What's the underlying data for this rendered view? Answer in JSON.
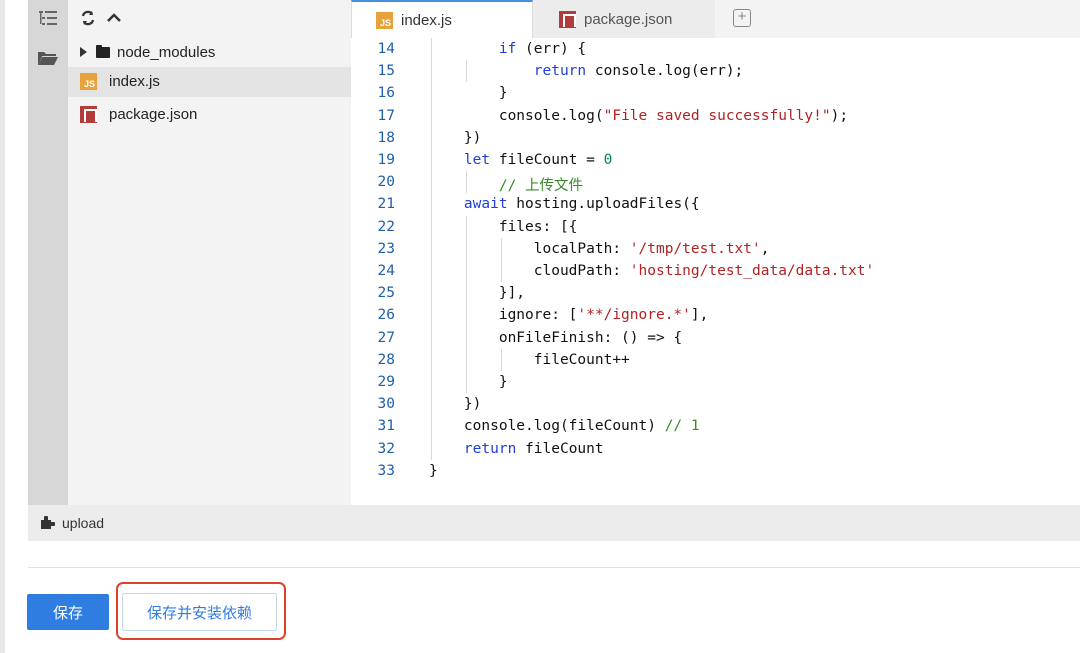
{
  "activity_bar": {
    "icons": [
      "outline-icon",
      "folder-icon"
    ]
  },
  "sidebar": {
    "toolbar_icons": [
      "refresh-icon",
      "collapse-icon"
    ],
    "tree": [
      {
        "type": "folder",
        "label": "node_modules",
        "icon": "folder-icon"
      },
      {
        "type": "file",
        "label": "index.js",
        "badge": "JS",
        "selected": true
      },
      {
        "type": "file",
        "label": "package.json",
        "icon": "npm-icon"
      }
    ]
  },
  "tabs": [
    {
      "label": "index.js",
      "badge": "JS",
      "active": true
    },
    {
      "label": "package.json",
      "icon": "npm-icon",
      "active": false
    }
  ],
  "add_tab_symbol": "+",
  "code": {
    "language": "javascript",
    "lines": [
      {
        "num": "14",
        "text": "        if (err) {"
      },
      {
        "num": "15",
        "text": "            return console.log(err);"
      },
      {
        "num": "16",
        "text": "        }"
      },
      {
        "num": "17",
        "text": "        console.log(\"File saved successfully!\");"
      },
      {
        "num": "18",
        "text": "    })"
      },
      {
        "num": "19",
        "text": "    let fileCount = 0"
      },
      {
        "num": "20",
        "text": "        // 上传文件"
      },
      {
        "num": "21",
        "text": "    await hosting.uploadFiles({"
      },
      {
        "num": "22",
        "text": "        files: [{"
      },
      {
        "num": "23",
        "text": "            localPath: '/tmp/test.txt',"
      },
      {
        "num": "24",
        "text": "            cloudPath: 'hosting/test_data/data.txt'"
      },
      {
        "num": "25",
        "text": "        }],"
      },
      {
        "num": "26",
        "text": "        ignore: ['**/ignore.*'],"
      },
      {
        "num": "27",
        "text": "        onFileFinish: () => {"
      },
      {
        "num": "28",
        "text": "            fileCount++"
      },
      {
        "num": "29",
        "text": "        }"
      },
      {
        "num": "30",
        "text": "    })"
      },
      {
        "num": "31",
        "text": "    console.log(fileCount) // 1"
      },
      {
        "num": "32",
        "text": "    return fileCount"
      },
      {
        "num": "33",
        "text": "}"
      }
    ]
  },
  "statusbar": {
    "label": "upload",
    "icon": "puzzle-icon"
  },
  "buttons": {
    "save": "保存",
    "save_install": "保存并安装依赖"
  },
  "colors": {
    "primary": "#2f7de1",
    "highlight": "#e0402a",
    "keyword": "#1f3fd8",
    "string": "#b22222",
    "number": "#098658",
    "comment": "#3a8a2a"
  }
}
